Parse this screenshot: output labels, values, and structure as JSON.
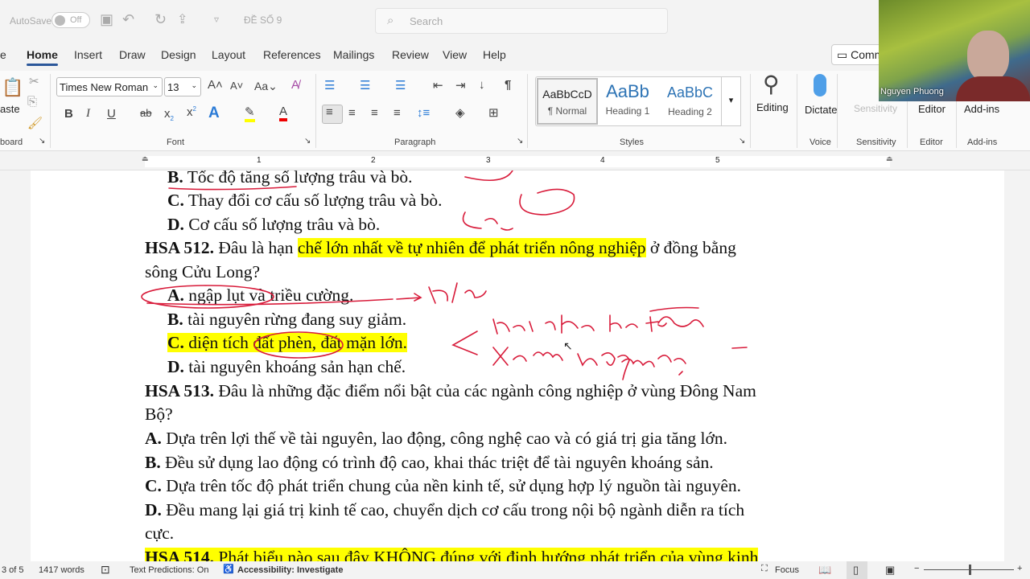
{
  "titlebar": {
    "autosave": "AutoSave",
    "autosave_state": "Off",
    "doc_title": "ĐỀ SỐ 9",
    "search_placeholder": "Search"
  },
  "tabs": [
    "e",
    "Home",
    "Insert",
    "Draw",
    "Design",
    "Layout",
    "References",
    "Mailings",
    "Review",
    "View",
    "Help"
  ],
  "comments_label": "Comm",
  "ribbon": {
    "paste": "aste",
    "clipboard": "board",
    "font_name": "Times New Roman",
    "font_size": "13",
    "font_group": "Font",
    "paragraph_group": "Paragraph",
    "styles": [
      {
        "preview": "AaBbCcD",
        "name": "¶ Normal"
      },
      {
        "preview": "AaBb",
        "name": "Heading 1"
      },
      {
        "preview": "AaBbC",
        "name": "Heading 2"
      }
    ],
    "styles_group": "Styles",
    "editing": "Editing",
    "dictate": "Dictate",
    "voice": "Voice",
    "sensitivity": "Sensitivity",
    "editor": "Editor",
    "addins": "Add-ins"
  },
  "video": {
    "name": "Nguyen Phuong"
  },
  "ruler": [
    "1",
    "1",
    "2",
    "3",
    "4",
    "5"
  ],
  "document": {
    "l1_b": "B.",
    "l1": " Tốc độ tăng số lượng trâu và bò.",
    "l2_b": "C.",
    "l2": " Thay đổi cơ cấu số lượng trâu và bò.",
    "l3_b": "D.",
    "l3": " Cơ cấu số lượng trâu và bò.",
    "q512_b": "HSA 512.",
    "q512_a": " Đâu là hạn ",
    "q512_hl": "chế lớn nhất về tự nhiên để phát triển nông nghiệp",
    "q512_c": " ở đồng bằng",
    "q512_2": "sông Cửu Long?",
    "a512_b": "A.",
    "a512": " ngập lụt và triều cường.",
    "b512_b": "B.",
    "b512": " tài nguyên rừng đang suy giảm.",
    "c512_b": "C.",
    "c512": " diện tích đất phèn, đất mặn lớn.",
    "d512_b": "D.",
    "d512": " tài nguyên khoáng sản hạn chế.",
    "q513_b": "HSA 513.",
    "q513": " Đâu là những đặc điểm nổi bật của các ngành công nghiệp ở vùng Đông Nam",
    "q513_2": "Bộ?",
    "a513_b": "A.",
    "a513": " Dựa trên lợi thế về tài nguyên, lao động, công nghệ cao và có giá trị gia tăng lớn.",
    "b513_b": "B.",
    "b513": " Đều sử dụng lao động có trình độ cao, khai thác triệt để tài nguyên khoáng sản.",
    "c513_b": "C.",
    "c513": " Dựa trên tốc độ phát triển chung của nền kinh tế, sử dụng hợp lý nguồn tài nguyên.",
    "d513_b": "D.",
    "d513": " Đều mang lại giá trị kinh tế cao, chuyển dịch cơ cấu trong nội bộ ngành diễn ra tích",
    "d513_2": "cực.",
    "q514_b": "HSA 514.",
    "q514": " Phát biểu nào sau đây KHÔNG đúng với định hướng phát triển của vùng kinh"
  },
  "status": {
    "page": "3 of 5",
    "words": "1417 words",
    "predictions": "Text Predictions: On",
    "accessibility": "Accessibility: Investigate",
    "focus": "Focus"
  }
}
